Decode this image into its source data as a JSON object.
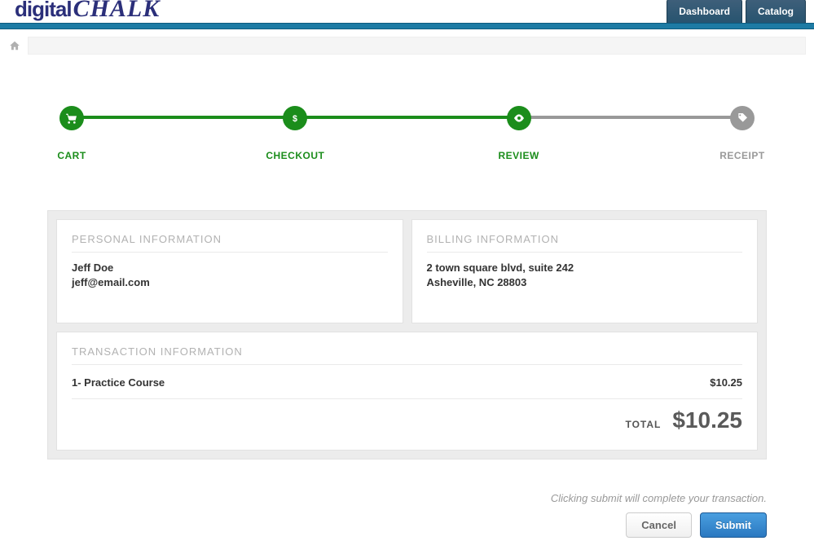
{
  "brand": {
    "part1": "digital",
    "part2": "CHALK"
  },
  "nav": {
    "dashboard": "Dashboard",
    "catalog": "Catalog"
  },
  "steps": [
    {
      "label": "CART",
      "state": "done"
    },
    {
      "label": "CHECKOUT",
      "state": "done"
    },
    {
      "label": "REVIEW",
      "state": "done"
    },
    {
      "label": "RECEIPT",
      "state": "todo"
    }
  ],
  "personal": {
    "heading": "PERSONAL INFORMATION",
    "name": "Jeff Doe",
    "email": "jeff@email.com"
  },
  "billing": {
    "heading": "BILLING INFORMATION",
    "line1": "2 town square blvd, suite 242",
    "line2": "Asheville, NC 28803"
  },
  "transaction": {
    "heading": "TRANSACTION INFORMATION",
    "items": [
      {
        "name": "1- Practice Course",
        "price": "$10.25"
      }
    ],
    "total_label": "TOTAL",
    "total_amount": "$10.25"
  },
  "footer": {
    "hint": "Clicking submit will complete your transaction.",
    "cancel": "Cancel",
    "submit": "Submit"
  }
}
